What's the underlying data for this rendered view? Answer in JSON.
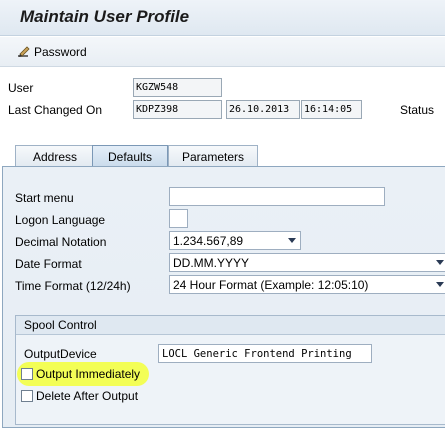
{
  "window": {
    "title": "Maintain User Profile"
  },
  "toolbar": {
    "password_label": "Password"
  },
  "header": {
    "user_label": "User",
    "user_value": "KGZW548",
    "last_changed_label": "Last Changed On",
    "last_changed_by": "KDPZ398",
    "last_changed_date": "26.10.2013",
    "last_changed_time": "16:14:05",
    "status_label": "Status"
  },
  "tabs": [
    {
      "label": "Address",
      "active": false
    },
    {
      "label": "Defaults",
      "active": true
    },
    {
      "label": "Parameters",
      "active": false
    }
  ],
  "defaults": {
    "start_menu_label": "Start menu",
    "start_menu_value": "",
    "logon_language_label": "Logon Language",
    "logon_language_value": "",
    "decimal_notation_label": "Decimal Notation",
    "decimal_notation_value": "1.234.567,89",
    "date_format_label": "Date Format",
    "date_format_value": "DD.MM.YYYY",
    "time_format_label": "Time Format (12/24h)",
    "time_format_value": "24 Hour Format (Example: 12:05:10)"
  },
  "spool": {
    "group_title": "Spool Control",
    "output_device_label": "OutputDevice",
    "output_device_value": "LOCL Generic Frontend Printing",
    "output_immediately_label": "Output Immediately",
    "output_immediately_checked": false,
    "delete_after_output_label": "Delete After Output",
    "delete_after_output_checked": false
  },
  "colors": {
    "highlight": "#f3ff3a",
    "tab_active": "#cbdcec",
    "panel_bg": "#e6edf4"
  }
}
